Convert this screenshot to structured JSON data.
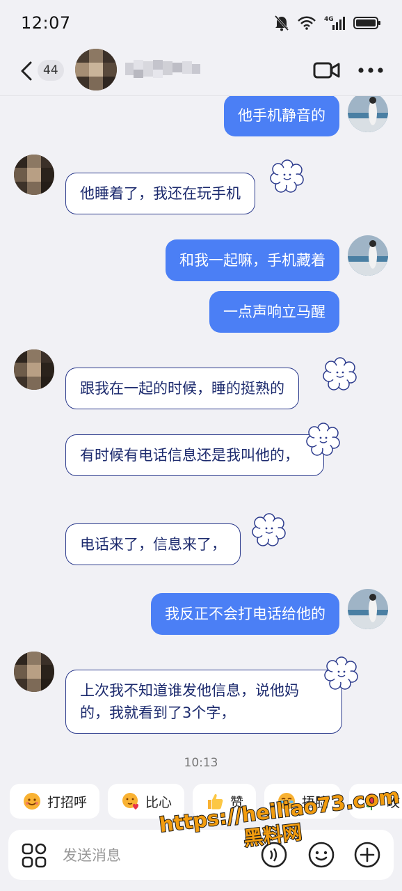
{
  "status_bar": {
    "time": "12:07",
    "network": "4G"
  },
  "header": {
    "unread_count": "44"
  },
  "messages": [
    {
      "side": "out",
      "text": "他手机静音的"
    },
    {
      "side": "in",
      "text": "他睡着了，我还在玩手机"
    },
    {
      "side": "out",
      "text": "和我一起嘛，手机藏着"
    },
    {
      "side": "out",
      "text": "一点声响立马醒"
    },
    {
      "side": "in",
      "text": "跟我在一起的时候，睡的挺熟的"
    },
    {
      "side": "in",
      "text": "有时候有电话信息还是我叫他的，"
    },
    {
      "side": "in",
      "text": "电话来了，信息来了，"
    },
    {
      "side": "out",
      "text": "我反正不会打电话给他的"
    },
    {
      "side": "in",
      "text": "上次我不知道谁发他信息，说他妈的，我就看到了3个字，"
    }
  ],
  "timestamp": "10:13",
  "quick_replies": [
    {
      "label": "打招呼",
      "icon": "smile-emoji-icon"
    },
    {
      "label": "比心",
      "icon": "heart-hands-emoji-icon"
    },
    {
      "label": "赞",
      "icon": "thumbs-up-emoji-icon"
    },
    {
      "label": "捂脸",
      "icon": "facepalm-emoji-icon"
    },
    {
      "label": "玫",
      "icon": "rose-emoji-icon"
    }
  ],
  "input": {
    "placeholder": "发送消息"
  },
  "watermark": {
    "url": "https://heiliao73.com",
    "name": "黑料网"
  },
  "colors": {
    "outgoing_bubble": "#4b7ff5",
    "incoming_border": "#2b3a8c",
    "incoming_text": "#1d2b6e",
    "background": "#f1f1f5"
  }
}
